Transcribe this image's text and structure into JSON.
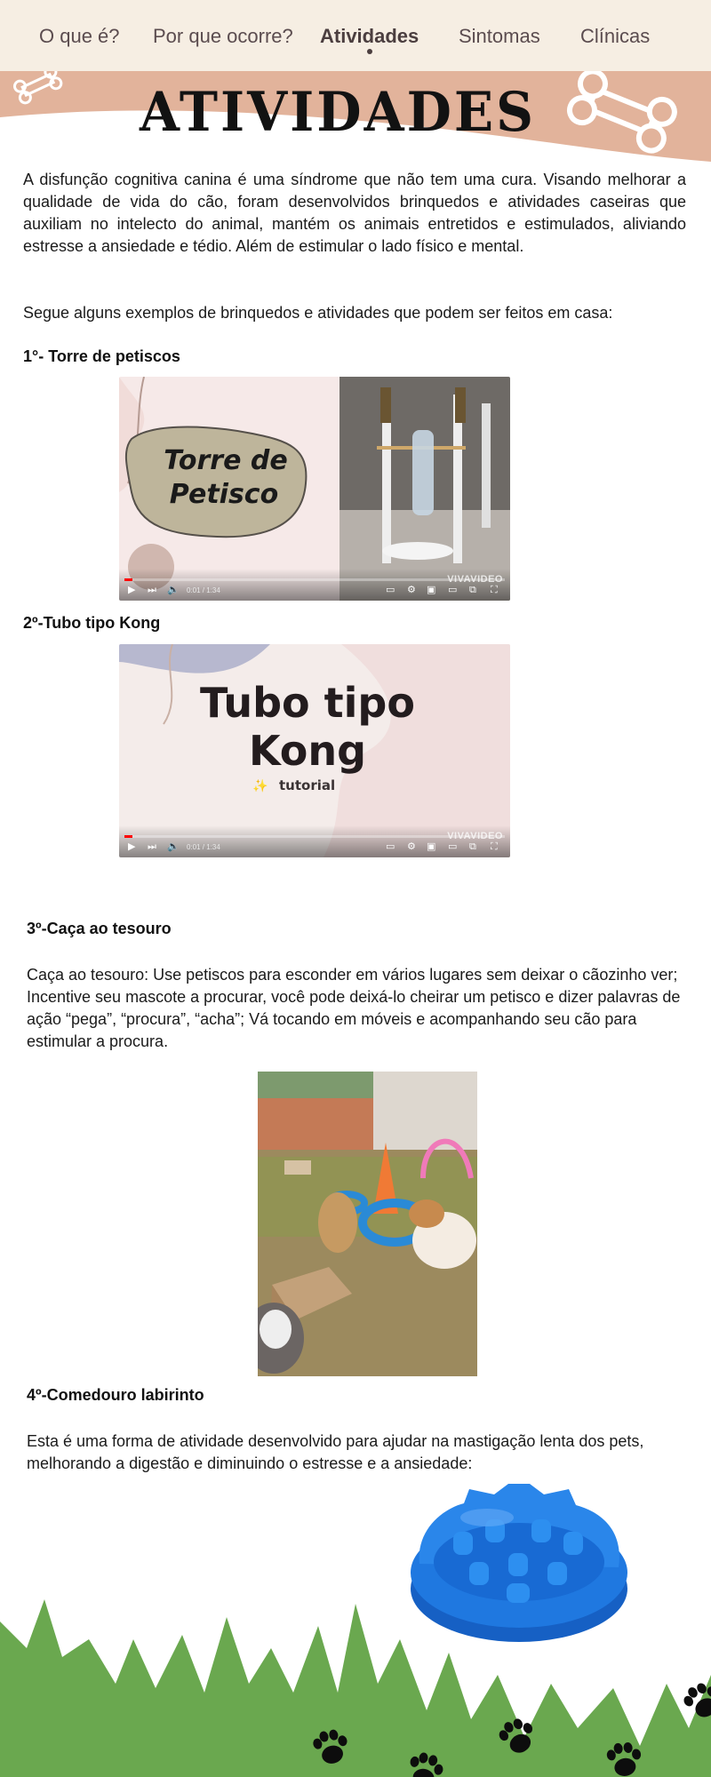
{
  "nav": {
    "items": [
      "O que é?",
      "Por que ocorre?",
      "Atividades",
      "Sintomas",
      "Clínicas"
    ],
    "active_index": 2
  },
  "header": {
    "title": "ATIVIDADES"
  },
  "intro": {
    "paragraph1": "A disfunção cognitiva canina é uma síndrome que não tem uma cura. Visando melhorar a qualidade de vida do cão, foram desenvolvidos brinquedos e atividades caseiras que auxiliam no intelecto do animal, mantém os animais entretidos e estimulados, aliviando estresse a ansiedade e tédio. Além de estimular o lado físico e mental.",
    "paragraph2": "Segue alguns exemplos de brinquedos e atividades que podem ser feitos em casa:"
  },
  "activities": [
    {
      "heading": "1°- Torre de petiscos",
      "video_title": "Torre de Petisco",
      "video_time": "0:01 / 1:34",
      "watermark": "VIVAVIDEO",
      "progress": 0.02
    },
    {
      "heading": "2º-Tubo tipo Kong",
      "video_title": "Tubo tipo Kong",
      "video_subtitle": "tutorial",
      "video_time": "0:01 / 1:34",
      "watermark": "VIVAVIDEO",
      "progress": 0.02
    },
    {
      "heading": "3º-Caça ao tesouro",
      "text": "Caça ao tesouro: Use petiscos para esconder em vários lugares sem deixar o cãozinho ver; Incentive seu mascote a procurar, você pode deixá-lo cheirar um petisco e dizer palavras de ação “pega”, “procura”, “acha”; Vá tocando em móveis e acompanhando seu cão para estimular a procura."
    },
    {
      "heading": "4º-Comedouro labirinto",
      "text": "Esta é uma forma de atividade desenvolvido para ajudar na mastigação lenta dos pets, melhorando a digestão e diminuindo o estresse e a ansiedade:"
    }
  ],
  "colors": {
    "nav_bg": "#f6eee3",
    "band": "#e2b39b",
    "grass": "#6aa84f",
    "bowl": "#1f78e0"
  }
}
